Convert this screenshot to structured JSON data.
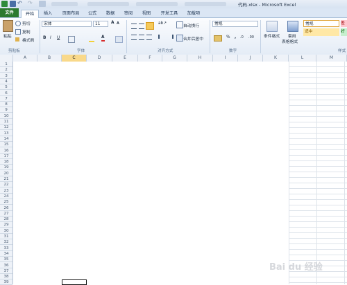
{
  "window": {
    "title": "代码.xlsx - Microsoft Excel"
  },
  "tabs": [
    "文件",
    "开始",
    "插入",
    "页面布局",
    "公式",
    "数据",
    "审阅",
    "视图",
    "开发工具",
    "加载项"
  ],
  "clipboard": {
    "paste": "粘贴",
    "cut": "剪切",
    "copy": "复制",
    "format_painter": "格式刷",
    "label": "剪贴板"
  },
  "font": {
    "name": "宋体",
    "size": "11",
    "label": "字体"
  },
  "alignment": {
    "wrap": "自动换行",
    "merge": "合并后居中",
    "label": "对齐方式"
  },
  "number": {
    "format": "常规",
    "label": "数字"
  },
  "styles": {
    "conditional": "条件格式",
    "table": "套用",
    "table2": "表格格式",
    "normal": "常规",
    "neutral": "适中",
    "bad": "差",
    "good": "好",
    "label": "样式"
  },
  "columns": [
    "A",
    "B",
    "C",
    "D",
    "E",
    "F",
    "G",
    "H",
    "I",
    "J",
    "K",
    "L",
    "M"
  ],
  "rows": [
    "1",
    "2",
    "3",
    "4",
    "5",
    "6",
    "7",
    "8",
    "9",
    "10",
    "11",
    "12",
    "13",
    "14",
    "15",
    "16",
    "17",
    "18",
    "19",
    "20",
    "21",
    "22",
    "23",
    "24",
    "25",
    "26",
    "27",
    "28",
    "29",
    "30",
    "31",
    "32",
    "33",
    "34",
    "35",
    "36",
    "37",
    "38",
    "39"
  ],
  "selected_column": "C",
  "colors": {
    "accent": "#2d7a2f",
    "selection": "#f9d98a"
  },
  "watermark": "Bai du 经验"
}
